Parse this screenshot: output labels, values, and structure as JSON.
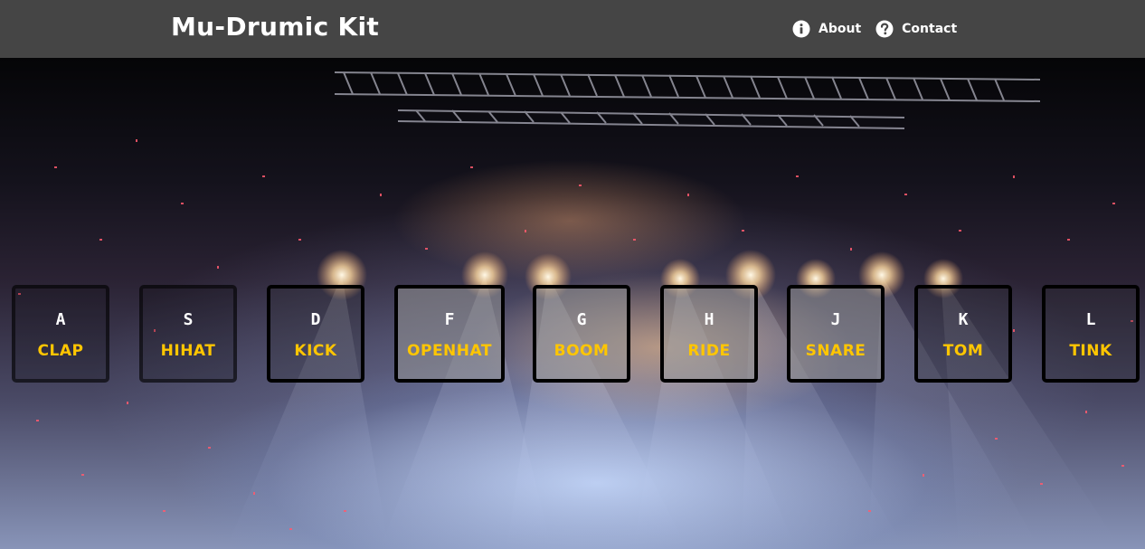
{
  "header": {
    "title": "Mu-Drumic Kit",
    "nav": [
      {
        "label": "About",
        "icon": "info-icon"
      },
      {
        "label": "Contact",
        "icon": "question-icon"
      }
    ]
  },
  "keys": [
    {
      "letter": "A",
      "sound": "CLAP"
    },
    {
      "letter": "S",
      "sound": "HIHAT"
    },
    {
      "letter": "D",
      "sound": "KICK"
    },
    {
      "letter": "F",
      "sound": "OPENHAT"
    },
    {
      "letter": "G",
      "sound": "BOOM"
    },
    {
      "letter": "H",
      "sound": "RIDE"
    },
    {
      "letter": "J",
      "sound": "SNARE"
    },
    {
      "letter": "K",
      "sound": "TOM"
    },
    {
      "letter": "L",
      "sound": "TINK"
    }
  ],
  "colors": {
    "navbar": "#454545",
    "key_label": "#ffc600",
    "key_letter": "#ffffff",
    "key_border": "#000000"
  },
  "background": "concert-stage-image"
}
